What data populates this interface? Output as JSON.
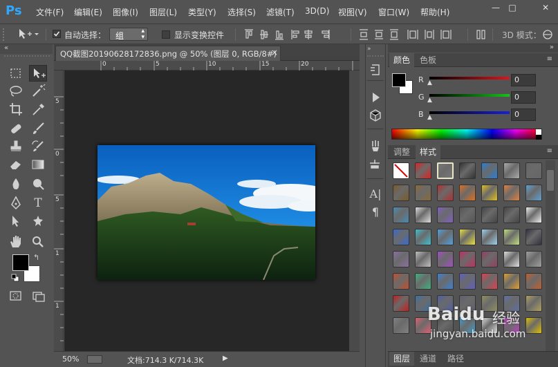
{
  "app": {
    "logo_text": "Ps",
    "menu": [
      "文件(F)",
      "编辑(E)",
      "图像(I)",
      "图层(L)",
      "类型(Y)",
      "选择(S)",
      "滤镜(T)",
      "3D(D)",
      "视图(V)",
      "窗口(W)",
      "帮助(H)"
    ],
    "window_controls": {
      "minimize": "—",
      "maximize": "□",
      "close": "✕"
    }
  },
  "options_bar": {
    "auto_select_label": "自动选择：",
    "auto_select_checked": true,
    "auto_select_value": "组",
    "show_transform_label": "显示变换控件",
    "show_transform_checked": false,
    "mode_3d_label": "3D 模式："
  },
  "document": {
    "tab_title": "QQ截图20190628172836.png @ 50% (图层 0, RGB/8#)",
    "tab_close": "×",
    "ruler_top_labels": [
      "0",
      "5",
      "10",
      "15",
      "20"
    ],
    "ruler_left_labels": [
      "5",
      "0",
      "5",
      "1",
      "1"
    ],
    "zoom": "50%",
    "doc_info": "文档:714.3 K/714.3K",
    "status_arrow": "▶"
  },
  "tools": [
    {
      "name": "marquee-tool",
      "glyph": "⬚",
      "selected": false
    },
    {
      "name": "move-tool",
      "glyph": "✥",
      "selected": true
    },
    {
      "name": "lasso-tool",
      "glyph": "◌",
      "selected": false
    },
    {
      "name": "magic-wand-tool",
      "glyph": "✸",
      "selected": false
    },
    {
      "name": "crop-tool",
      "glyph": "⌗",
      "selected": false
    },
    {
      "name": "eyedropper-tool",
      "glyph": "⁄",
      "selected": false
    },
    {
      "name": "healing-brush-tool",
      "glyph": "✚",
      "selected": false
    },
    {
      "name": "brush-tool",
      "glyph": "✎",
      "selected": false
    },
    {
      "name": "clone-stamp-tool",
      "glyph": "⊥",
      "selected": false
    },
    {
      "name": "history-brush-tool",
      "glyph": "↺",
      "selected": false
    },
    {
      "name": "eraser-tool",
      "glyph": "▱",
      "selected": false
    },
    {
      "name": "gradient-tool",
      "glyph": "▣",
      "selected": false
    },
    {
      "name": "blur-tool",
      "glyph": "●",
      "selected": false
    },
    {
      "name": "dodge-tool",
      "glyph": "◐",
      "selected": false
    },
    {
      "name": "pen-tool",
      "glyph": "✒",
      "selected": false
    },
    {
      "name": "type-tool",
      "glyph": "T",
      "selected": false
    },
    {
      "name": "path-selection-tool",
      "glyph": "➤",
      "selected": false
    },
    {
      "name": "shape-tool",
      "glyph": "✱",
      "selected": false
    },
    {
      "name": "hand-tool",
      "glyph": "✋",
      "selected": false
    },
    {
      "name": "zoom-tool",
      "glyph": "⚲",
      "selected": false
    }
  ],
  "colors": {
    "foreground": "#000000",
    "background": "#ffffff"
  },
  "color_panel": {
    "tabs": [
      "颜色",
      "色板"
    ],
    "active_tab": 0,
    "channels": [
      {
        "label": "R",
        "value": "0",
        "color": "#e0141a"
      },
      {
        "label": "G",
        "value": "0",
        "color": "#16c21c"
      },
      {
        "label": "B",
        "value": "0",
        "color": "#1820d8"
      }
    ]
  },
  "styles_panel": {
    "tabs": [
      "调整",
      "样式"
    ],
    "active_tab": 1
  },
  "bottom_panel": {
    "tabs": [
      "图层",
      "通道",
      "路径"
    ],
    "active_tab": 0
  },
  "watermark": {
    "brand": "Baidu",
    "brand_cn": "经验",
    "url": "jingyan.baidu.com"
  }
}
